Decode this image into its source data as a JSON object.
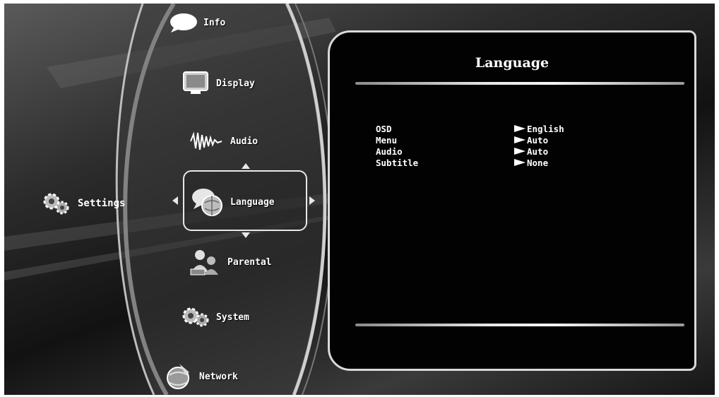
{
  "left": {
    "label": "Settings",
    "icon": "gears-icon"
  },
  "menu": [
    {
      "label": "Info",
      "icon": "speech-bubble-icon"
    },
    {
      "label": "Display",
      "icon": "monitor-icon"
    },
    {
      "label": "Audio",
      "icon": "sound-wave-icon"
    },
    {
      "label": "Language",
      "icon": "language-bubbles-icon",
      "selected": true
    },
    {
      "label": "Parental",
      "icon": "users-lock-icon"
    },
    {
      "label": "System",
      "icon": "gears-icon"
    },
    {
      "label": "Network",
      "icon": "globe-icon"
    }
  ],
  "panel": {
    "title": "Language",
    "rows": [
      {
        "label": "OSD",
        "value": "English"
      },
      {
        "label": "Menu",
        "value": "Auto"
      },
      {
        "label": "Audio",
        "value": "Auto"
      },
      {
        "label": "Subtitle",
        "value": "None"
      }
    ]
  }
}
